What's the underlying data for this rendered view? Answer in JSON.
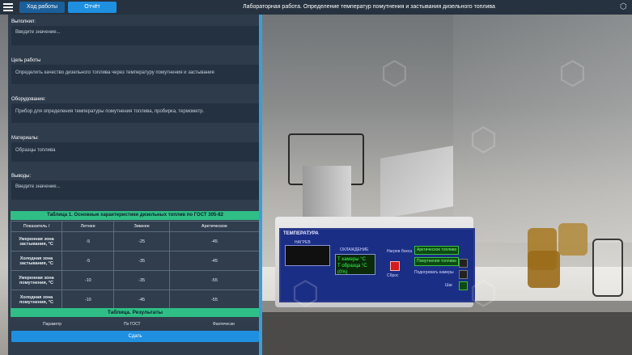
{
  "topbar": {
    "tab_progress": "Ход работы",
    "tab_report": "Отчёт",
    "title": "Лабораторная работа. Определение температур помутнения и застывания дизельного топлива"
  },
  "report": {
    "executed_label": "Выполнил:",
    "executed_placeholder": "Введите значение...",
    "goal_label": "Цель работы",
    "goal_text": "Определить качество дизельного топлива через температуру помутнения и застывания",
    "equipment_label": "Оборудование:",
    "equipment_text": "Прибор для определения температуры помутнения топлива, пробирка, термометр.",
    "materials_label": "Материалы:",
    "materials_text": "Образцы топлива",
    "conclusions_label": "Выводы:",
    "conclusions_placeholder": "Введите значение..."
  },
  "table1": {
    "title": "Таблица 1.  Основные характеристики дизельных топлив по ГОСТ 305-82",
    "columns": [
      "Показатель /",
      "Летнее",
      "Зимнее",
      "Арктическое"
    ],
    "rows": [
      {
        "label": "Умеренная зона застывания, °С",
        "values": [
          "-5",
          "-25",
          "-45"
        ]
      },
      {
        "label": "Холодная зона застывания, °С",
        "values": [
          "-5",
          "-35",
          "-45"
        ]
      },
      {
        "label": "Умеренная зона помутнения, °С",
        "values": [
          "-10",
          "-35",
          "-55"
        ]
      },
      {
        "label": "Холодная зона помутнения, °С",
        "values": [
          "-10",
          "-45",
          "-55"
        ]
      }
    ]
  },
  "results": {
    "title": "Таблица. Результаты",
    "columns": [
      "Параметр",
      "По ГОСТ",
      "Фактически"
    ],
    "submit_label": "Сдать"
  },
  "device": {
    "panel_title": "ТЕМПЕРАТУРА",
    "heat_label": "НАГРЕВ",
    "cool_label": "ОХЛАЖДЕНИЕ",
    "lcd_red": "",
    "lcd_green_line1": "Т камеры    °С",
    "lcd_green_line2": "Т образца   °С",
    "lcd_green_line3": "(0%)",
    "btn_arctic": "Арктическое топливо",
    "btn_cloud": "Помутнение топлива",
    "btn_heat_chamber": "Подогревать камеры",
    "btn_step": "Шаг",
    "btn_reset": "Сброс",
    "btn_start": "Нагрев бокса"
  },
  "colors": {
    "accent": "#1f8fe0",
    "table_header": "#2fbf86",
    "panel_bg": "#2b3949",
    "topbar_bg": "#26323f"
  }
}
